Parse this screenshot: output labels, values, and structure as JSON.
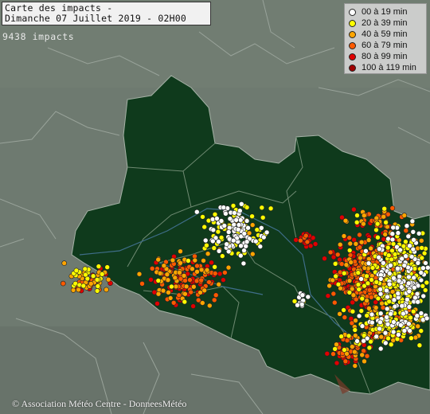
{
  "title": {
    "line1": "Carte des impacts -",
    "line2": "Dimanche 07 Juillet 2019 - 02H00"
  },
  "impact_count": "9438 impacts",
  "legend": {
    "items": [
      {
        "label": "00 à 19 min",
        "color": "#ffffff"
      },
      {
        "label": "20 à 39 min",
        "color": "#ffff00"
      },
      {
        "label": "40 à 59 min",
        "color": "#ffa500"
      },
      {
        "label": "60 à 79 min",
        "color": "#ff5a00"
      },
      {
        "label": "80 à 99 min",
        "color": "#e00000"
      },
      {
        "label": "100 à 119 min",
        "color": "#a00000"
      }
    ]
  },
  "credit": "© Association Météo Centre - DonneesMétéo",
  "colors": {
    "region_fill": "#0f3a1c",
    "background": "#6f7a70",
    "border": "#9aa59b",
    "highlight_border": "#8aa08d"
  }
}
